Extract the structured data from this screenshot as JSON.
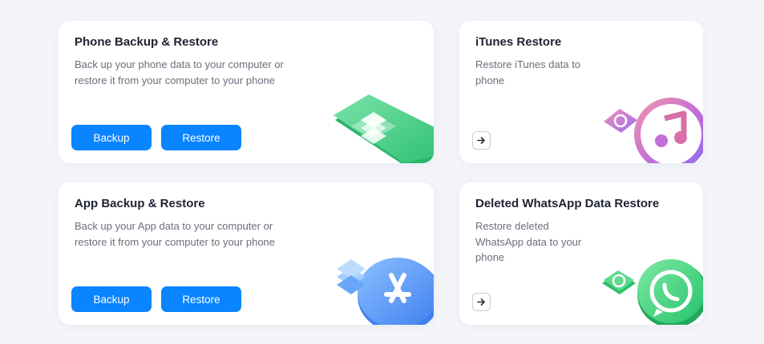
{
  "cards": [
    {
      "title": "Phone Backup & Restore",
      "desc_lines": [
        "Back up your phone data to your computer or",
        "restore it from your computer to your phone"
      ],
      "backup_label": "Backup",
      "restore_label": "Restore"
    },
    {
      "title": "iTunes Restore",
      "desc_lines": [
        "Restore iTunes data to",
        "phone"
      ]
    },
    {
      "title": "App Backup & Restore",
      "desc_lines": [
        "Back up your App data to your computer or",
        "restore it from your computer to your phone"
      ],
      "backup_label": "Backup",
      "restore_label": "Restore"
    },
    {
      "title": "Deleted WhatsApp Data Restore",
      "desc_lines": [
        "Restore deleted",
        "WhatsApp data to your",
        "phone"
      ]
    }
  ],
  "icons": {
    "phone_illustration": "phone-backup-icon",
    "itunes_illustration": "itunes-music-icon",
    "app_illustration": "app-store-icon",
    "whatsapp_illustration": "whatsapp-icon",
    "arrow": "arrow-right-icon"
  },
  "colors": {
    "primary_button": "#0a84ff",
    "background": "#f3f5f9",
    "card": "#ffffff",
    "title": "#1f2233",
    "description": "#6b6f7c"
  }
}
